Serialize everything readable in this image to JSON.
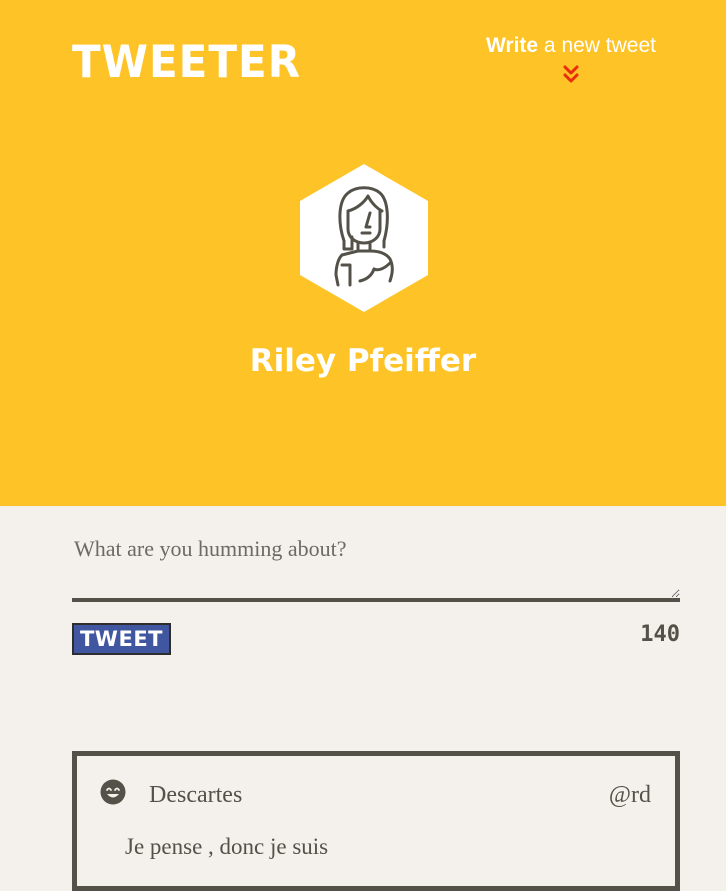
{
  "header": {
    "logo": "TWEETER",
    "compose_bold": "Write",
    "compose_rest": " a new tweet",
    "toggle_icon": "double-chevron-down-icon"
  },
  "profile": {
    "name": "Riley Pfeiffer",
    "avatar_icon": "female-avatar-icon"
  },
  "composer": {
    "placeholder": "What are you humming about?",
    "value": "",
    "button_label": "TWEET",
    "counter": "140"
  },
  "tweets": [
    {
      "author": "Descartes",
      "handle": "@rd",
      "text": "Je pense , donc je suis",
      "avatar_icon": "smiley-face-icon"
    }
  ],
  "colors": {
    "accent": "#fec326",
    "background": "#f4f1ec",
    "text": "#545149",
    "button": "#4056a1",
    "toggle": "#e82c0c"
  }
}
